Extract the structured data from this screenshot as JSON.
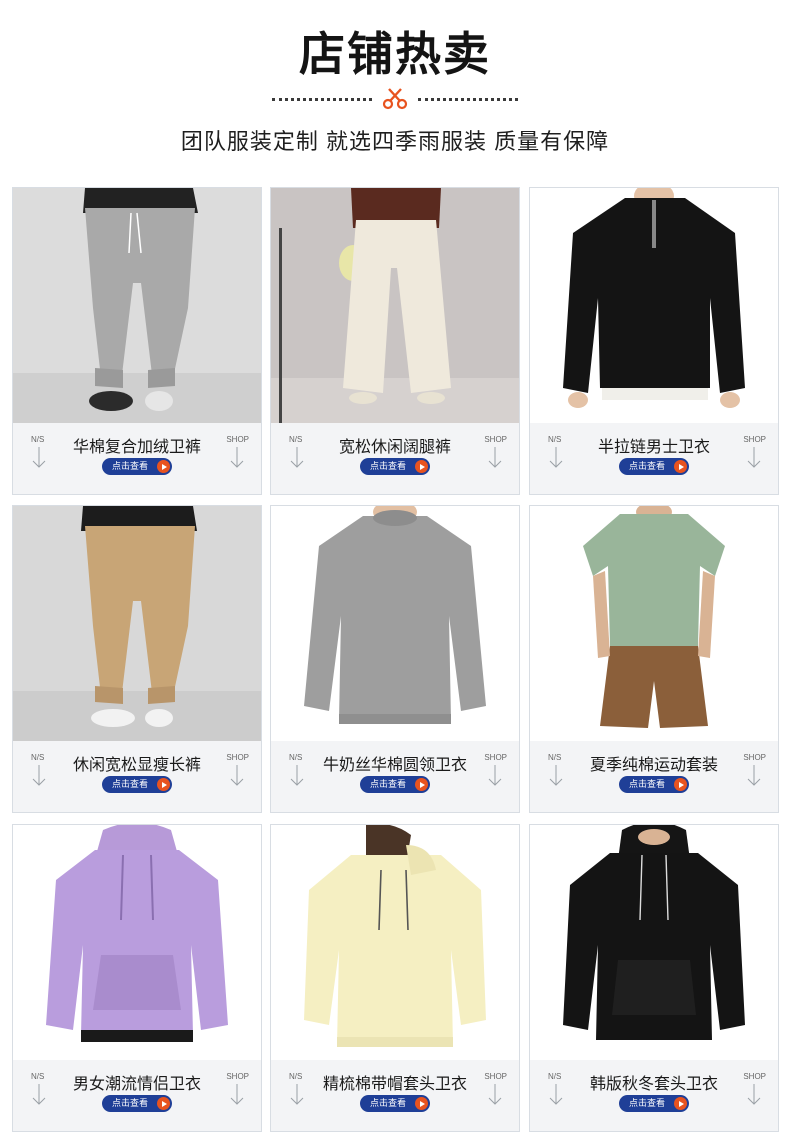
{
  "header": {
    "title": "店铺热卖",
    "subtitle": "团队服装定制 就选四季雨服装 质量有保障"
  },
  "card_labels": {
    "ns": "N/S",
    "shop": "SHOP",
    "view_button": "点击查看"
  },
  "colors": {
    "accent": "#1f3f97",
    "play": "#e8531f",
    "scissors": "#e8531f"
  },
  "products": [
    {
      "name": "华棉复合加绒卫裤",
      "item": "gray jogger pants"
    },
    {
      "name": "宽松休闲阔腿裤",
      "item": "cream wide-leg pants"
    },
    {
      "name": "半拉链男士卫衣",
      "item": "black half-zip sweatshirt"
    },
    {
      "name": "休闲宽松显瘦长裤",
      "item": "khaki jogger pants"
    },
    {
      "name": "牛奶丝华棉圆领卫衣",
      "item": "gray crewneck sweatshirt"
    },
    {
      "name": "夏季纯棉运动套装",
      "item": "sage t-shirt and brown shorts"
    },
    {
      "name": "男女潮流情侣卫衣",
      "item": "lavender hoodie"
    },
    {
      "name": "精梳棉带帽套头卫衣",
      "item": "pale yellow hoodie"
    },
    {
      "name": "韩版秋冬套头卫衣",
      "item": "black hoodie"
    }
  ]
}
